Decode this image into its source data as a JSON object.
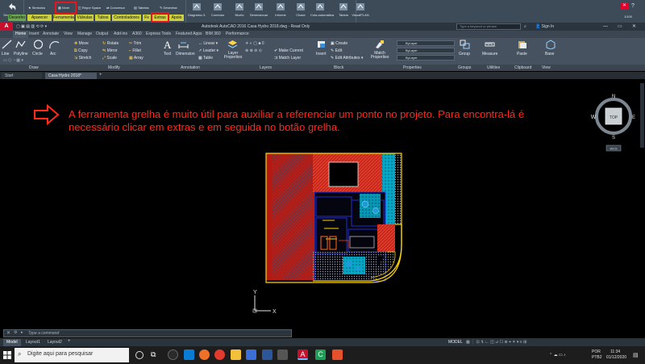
{
  "plugin_ribbon": {
    "top_buttons": [
      "Simbolos",
      "Nível",
      "Repor Space",
      "Conversor",
      "Tabelas",
      "Desenhar"
    ],
    "big_buttons": [
      "Diagrama /1",
      "Conectar",
      "Nivelo",
      "Dimensionar",
      "Informe",
      "Chave",
      "Cota automática",
      "Tabela",
      "VisualPLAN"
    ],
    "left_label": "Desprender",
    "tabs": [
      "Desenho",
      "Aparecer",
      "Ferramentas",
      "Válvulas",
      "Tubos",
      "Controladores",
      "Fx",
      "Extras",
      "Apoio"
    ],
    "highlighted_tab": "Extras",
    "tab_colors": [
      "#6aa84f",
      "#cdd23a",
      "#cdd23a",
      "#cdd23a",
      "#cdd23a",
      "#cdd23a",
      "#cdd23a",
      "#cdd23a",
      "#cdd23a"
    ],
    "page_counter": "1/100"
  },
  "window": {
    "title": "Autodesk AutoCAD 2016   Casa Hydro 2018.dwg - Read Only",
    "search_placeholder": "Type a keyword or phrase",
    "sign_in": "Sign In"
  },
  "ribbon_tabs": [
    "Home",
    "Insert",
    "Annotate",
    "View",
    "Manage",
    "Output",
    "Add-ins",
    "A360",
    "Express Tools",
    "Featured Apps",
    "BIM 360",
    "Performance"
  ],
  "ribbon": {
    "draw": [
      "Line",
      "Polyline",
      "Circle",
      "Arc"
    ],
    "modify": [
      "Move",
      "Rotate",
      "Trim",
      "Copy",
      "Mirror",
      "Fillet",
      "Stretch",
      "Scale",
      "Array"
    ],
    "annotation": [
      "Text",
      "Dimension",
      "Linear",
      "Leader",
      "Table"
    ],
    "layers": [
      "Layer Properties",
      "Make Current",
      "Match Layer"
    ],
    "block": [
      "Insert",
      "Create",
      "Edit",
      "Edit Attributes"
    ],
    "properties": [
      "Match Properties",
      "ByLayer",
      "ByLayer",
      "ByLayer"
    ],
    "groups": [
      "Group"
    ],
    "utilities": [
      "Measure"
    ],
    "clipboard": [
      "Paste"
    ],
    "view": [
      "Base"
    ]
  },
  "panel_labels": [
    "Draw",
    "Modify",
    "Annotation",
    "Layers",
    "Block",
    "Properties",
    "Groups",
    "Utilities",
    "Clipboard",
    "View"
  ],
  "doc_tabs": [
    "Start",
    "Casa Hydro 2018*"
  ],
  "annotation_text": "A ferramenta grelha é muito útil para auxiliar a referenciar um ponto no projeto. Para encontra-lá é necessário clicar em extras e em seguida no botão grelha.",
  "viewcube": {
    "top": "TOP",
    "n": "N",
    "s": "S",
    "e": "E",
    "w": "W",
    "wcs": "WCS"
  },
  "ucs": {
    "x": "X",
    "y": "Y"
  },
  "command_line": {
    "placeholder": "Type a command"
  },
  "layout_tabs": [
    "Model",
    "Layout1",
    "Layout2"
  ],
  "status_bar": {
    "model": "MODEL"
  },
  "taskbar": {
    "search_placeholder": "Digite aqui para pesquisar",
    "language": "POR",
    "keyboard": "PTB2",
    "time": "11:34",
    "date": "01/12/2020"
  }
}
